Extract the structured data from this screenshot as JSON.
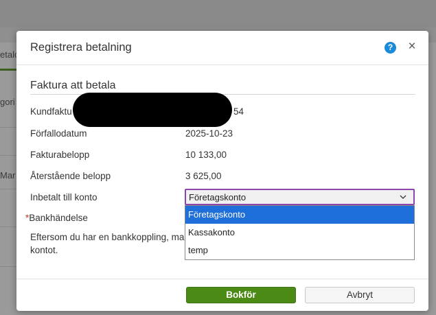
{
  "background": {
    "tab_label": "etalo",
    "row1_text": "gori",
    "row2_text": "Mar"
  },
  "modal": {
    "title": "Registrera betalning",
    "help_icon": "?",
    "close_icon": "×",
    "section_title": "Faktura att betala",
    "fields": {
      "invoice_label": "Kundfaktu",
      "invoice_value_tail": "54",
      "due_date_label": "Förfallodatum",
      "due_date_value": "2025-10-23",
      "amount_label": "Fakturabelopp",
      "amount_value": "10 133,00",
      "remaining_label": "Återstående belopp",
      "remaining_value": "3 625,00",
      "account_label": "Inbetalt till konto",
      "bank_required_mark": "*",
      "bank_label": "Bankhändelse"
    },
    "info_text_line1": "Eftersom du har en bankkoppling, ma",
    "info_text_line2": "kontot.",
    "account_select": {
      "selected": "Företagskonto",
      "options": [
        "Företagskonto",
        "Kassakonto",
        "temp"
      ]
    },
    "buttons": {
      "book": "Bokför",
      "cancel": "Avbryt"
    }
  },
  "colors": {
    "primary_button": "#4c8a16",
    "select_focus_border": "#8e44ad",
    "selected_option": "#1e6fd9",
    "help_icon": "#1b8ad8"
  }
}
